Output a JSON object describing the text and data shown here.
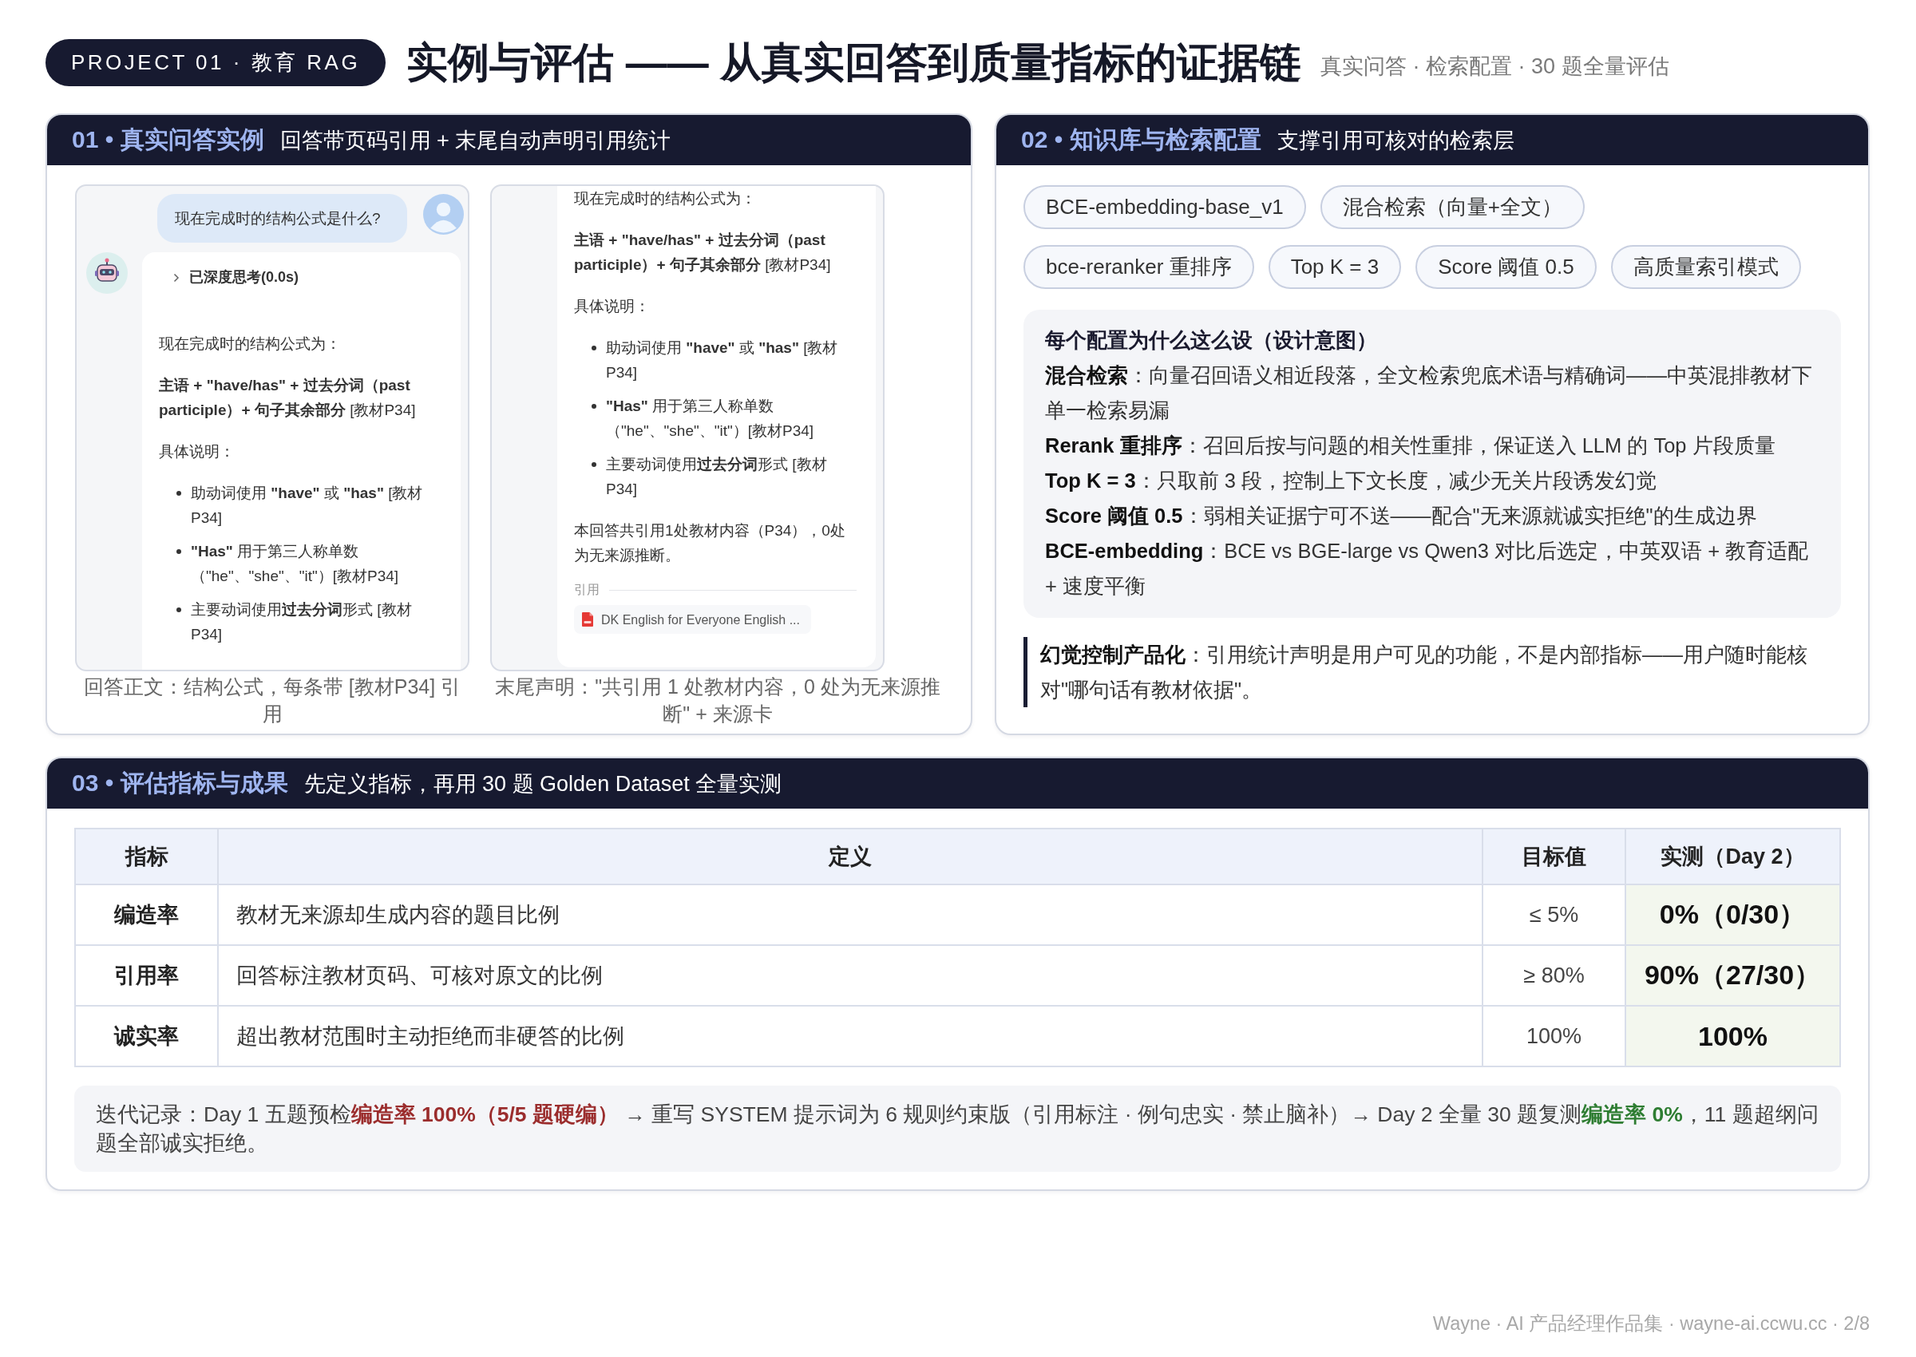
{
  "header": {
    "badge": "PROJECT 01 · 教育 RAG",
    "title": "实例与评估 —— 从真实回答到质量指标的证据链",
    "subtitle": "真实问答 · 检索配置 · 30 题全量评估"
  },
  "section_01": {
    "heading": "01 • 真实问答实例",
    "subtitle": "回答带页码引用 + 末尾自动声明引用统计",
    "screenshots": [
      {
        "question": "现在完成时的结构公式是什么?",
        "thinking": "已深度思考(0.0s)",
        "blocks": [
          {
            "kind": "paragraph",
            "text": "现在完成时的结构公式为："
          },
          {
            "kind": "paragraph",
            "text": "**主语 + \"have/has\" + 过去分词（past participle）+ 句子其余部分** [教材P34]"
          },
          {
            "kind": "paragraph",
            "text": "具体说明："
          },
          {
            "kind": "list",
            "items": [
              "助动词使用 **\"have\"** 或 **\"has\"** [教材P34]",
              "**\"Has\"** 用于第三人称单数（\"he\"、\"she\"、\"it\"）[教材P34]",
              "主要动词使用**过去分词**形式 [教材P34]"
            ]
          }
        ],
        "caption": "回答正文：结构公式，每条带 [教材P34] 引用"
      },
      {
        "blocks": [
          {
            "kind": "paragraph",
            "text": "现在完成时的结构公式为："
          },
          {
            "kind": "paragraph",
            "text": "**主语 + \"have/has\" + 过去分词（past participle）+ 句子其余部分** [教材P34]"
          },
          {
            "kind": "paragraph",
            "text": "具体说明："
          },
          {
            "kind": "list",
            "items": [
              "助动词使用 **\"have\"** 或 **\"has\"** [教材P34]",
              "**\"Has\"** 用于第三人称单数（\"he\"、\"she\"、\"it\"）[教材P34]",
              "主要动词使用**过去分词**形式 [教材P34]"
            ]
          },
          {
            "kind": "paragraph",
            "text": "本回答共引用1处教材内容（P34），0处为无来源推断。"
          }
        ],
        "citations": {
          "label": "引用",
          "source": "DK English for Everyone English ..."
        },
        "caption": "末尾声明：\"共引用 1 处教材内容，0 处为无来源推断\" + 来源卡"
      }
    ]
  },
  "section_02": {
    "heading": "02 • 知识库与检索配置",
    "subtitle": "支撑引用可核对的检索层",
    "tag_rows": [
      [
        "BCE-embedding-base_v1",
        "混合检索（向量+全文）"
      ],
      [
        "bce-reranker 重排序",
        "Top K = 3",
        "Score 阈值 0.5",
        "高质量索引模式"
      ]
    ],
    "design_notes": {
      "title": "每个配置为什么这么设（设计意图）",
      "items": [
        "**混合检索**：向量召回语义相近段落，全文检索兜底术语与精确词——中英混排教材下单一检索易漏",
        "**Rerank 重排序**：召回后按与问题的相关性重排，保证送入 LLM 的 Top 片段质量",
        "**Top K = 3**：只取前 3 段，控制上下文长度，减少无关片段诱发幻觉",
        "**Score 阈值 0.5**：弱相关证据宁可不送——配合\"无来源就诚实拒绝\"的生成边界",
        "**BCE-embedding**：BCE vs BGE-large vs Qwen3 对比后选定，中英双语 + 教育适配 + 速度平衡"
      ]
    },
    "callout": "**幻觉控制产品化**：引用统计声明是用户可见的功能，不是内部指标——用户随时能核对\"哪句话有教材依据\"。"
  },
  "section_03": {
    "heading": "03 • 评估指标与成果",
    "subtitle": "先定义指标，再用 30 题 Golden Dataset 全量实测",
    "table": {
      "columns": [
        "指标",
        "定义",
        "目标值",
        "实测（Day 2）"
      ],
      "rows": [
        {
          "metric": "编造率",
          "definition": "教材无来源却生成内容的题目比例",
          "target": "≤ 5%",
          "actual": "0%（0/30）"
        },
        {
          "metric": "引用率",
          "definition": "回答标注教材页码、可核对原文的比例",
          "target": "≥ 80%",
          "actual": "90%（27/30）"
        },
        {
          "metric": "诚实率",
          "definition": "超出教材范围时主动拒绝而非硬答的比例",
          "target": "100%",
          "actual": "100%"
        }
      ]
    },
    "iteration_note": [
      {
        "kind": "plain",
        "text": "迭代记录：Day 1 五题预检"
      },
      {
        "kind": "bad",
        "text": "编造率 100%（5/5 题硬编）"
      },
      {
        "kind": "plain",
        "text": " → 重写 SYSTEM 提示词为 6 规则约束版（引用标注 · 例句忠实 · 禁止脑补）→ Day 2 全量 30 题复测"
      },
      {
        "kind": "good",
        "text": "编造率 0%"
      },
      {
        "kind": "plain",
        "text": "，11 题超纲问题全部诚实拒绝。"
      }
    ]
  },
  "footer": "Wayne · AI 产品经理作品集 · wayne-ai.ccwu.cc · 2/8"
}
